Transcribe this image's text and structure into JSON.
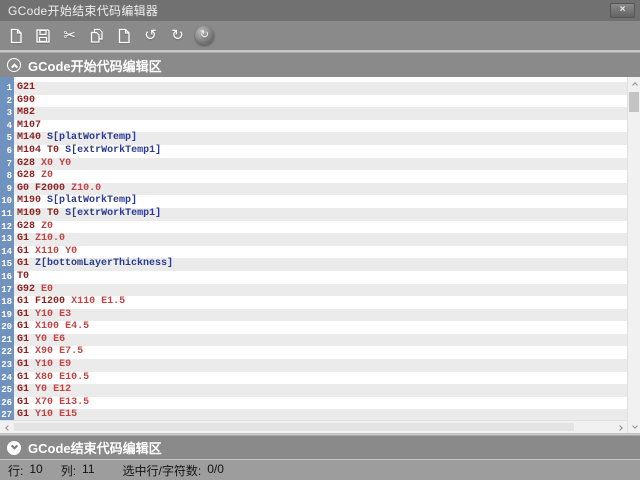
{
  "window": {
    "title": "GCode开始结束代码编辑器",
    "close_glyph": "×"
  },
  "toolbar": {
    "buttons": [
      {
        "name": "new-file"
      },
      {
        "name": "save"
      },
      {
        "name": "cut",
        "glyph": "✂"
      },
      {
        "name": "copy"
      },
      {
        "name": "paste"
      },
      {
        "name": "undo",
        "glyph": "↺"
      },
      {
        "name": "redo",
        "glyph": "↻"
      },
      {
        "name": "reset",
        "glyph": "↻"
      }
    ]
  },
  "sections": {
    "start": {
      "label": "GCode开始代码编辑区"
    },
    "end": {
      "label": "GCode结束代码编辑区"
    }
  },
  "editor": {
    "lines": [
      "G21",
      "G90",
      "M82",
      "M107",
      "M140 S[platWorkTemp]",
      "M104 T0 S[extrWorkTemp1]",
      "G28 X0 Y0",
      "G28 Z0",
      "G0 F2000 Z10.0",
      "M190 S[platWorkTemp]",
      "M109 T0 S[extrWorkTemp1]",
      "G28 Z0",
      "G1 Z10.0",
      "G1 X110 Y0",
      "G1 Z[bottomLayerThickness]",
      "T0",
      "G92 E0",
      "G1 F1200 X110 E1.5",
      "G1 Y10 E3",
      "G1 X100 E4.5",
      "G1 Y0 E6",
      "G1 X90 E7.5",
      "G1 Y10 E9",
      "G1 X80 E10.5",
      "G1 Y0 E12",
      "G1 X70 E13.5",
      "G1 Y10 E15"
    ]
  },
  "status": {
    "line_label": "行:",
    "line_value": "10",
    "col_label": "列:",
    "col_value": "11",
    "selection_label": "选中行/字符数:",
    "selection_value": "0/0"
  },
  "colors": {
    "command": "#8b2323",
    "parameter": "#c04545",
    "variable": "#2b3a8f",
    "gutter_bg": "#7092be"
  }
}
